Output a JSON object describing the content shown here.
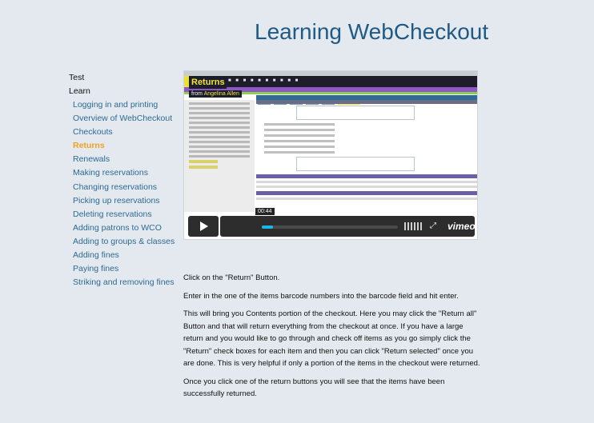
{
  "header": {
    "title": "Learning WebCheckout"
  },
  "sidebar": {
    "top_items": [
      {
        "label": "Test"
      },
      {
        "label": "Learn"
      }
    ],
    "items": [
      {
        "label": "Logging in and printing"
      },
      {
        "label": "Overview of WebCheckout"
      },
      {
        "label": "Checkouts"
      },
      {
        "label": "Returns",
        "active": true
      },
      {
        "label": "Renewals"
      },
      {
        "label": "Making reservations"
      },
      {
        "label": "Changing reservations"
      },
      {
        "label": "Picking up reservations"
      },
      {
        "label": "Deleting reservations"
      },
      {
        "label": "Adding patrons to WCO"
      },
      {
        "label": "Adding to groups & classes"
      },
      {
        "label": "Adding fines"
      },
      {
        "label": "Paying fines"
      },
      {
        "label": "Striking and removing fines"
      }
    ]
  },
  "video": {
    "screen_title": "Returns",
    "byline_prefix": "from",
    "byline_author": "Angelina Allen",
    "time": "00:44",
    "progress_fraction": 0.08,
    "brand": "vimeo",
    "play_icon": "play-icon",
    "fullscreen_icon": "fullscreen-icon"
  },
  "content": {
    "paragraphs": [
      "Click on the \"Return\" Button.",
      "Enter in the one of the items barcode numbers into the barcode field and hit enter.",
      "This will bring you Contents portion of the checkout. Here you may click the \"Return all\" Button and that will return everything from the checkout at once. If you have a large return and you would like to go through and check off items as you go simply click the \"Return\" check boxes for each item and then you can click \"Return selected\" once you are done. This is very helpful if only a portion of the items in the checkout were returned.",
      "Once you click one of the return buttons you will see that the items have been successfully returned."
    ]
  },
  "colors": {
    "title": "#1f5a85",
    "link": "#2e6a92",
    "active": "#f2a11f",
    "background": "#e3e9ef",
    "vimeo_accent": "#1ab7ea"
  }
}
